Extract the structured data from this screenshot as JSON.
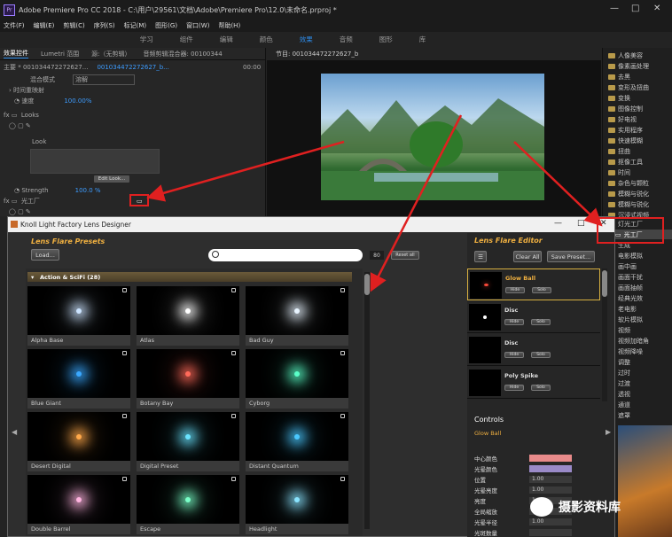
{
  "titlebar": {
    "title": "Adobe Premiere Pro CC 2018 - C:\\用户\\29561\\文档\\Adobe\\Premiere Pro\\12.0\\未命名.prproj *",
    "logo": "Pr"
  },
  "menu": [
    "文件(F)",
    "编辑(E)",
    "剪辑(C)",
    "序列(S)",
    "标记(M)",
    "图形(G)",
    "窗口(W)",
    "帮助(H)"
  ],
  "workspaces": {
    "items": [
      "学习",
      "组件",
      "编辑",
      "颜色",
      "效果",
      "音频",
      "图形",
      "库"
    ],
    "active": "效果"
  },
  "ec": {
    "tabs": [
      "效果控件",
      "Lumetri 范围",
      "源:（无剪辑）",
      "音频剪辑混合器: 00100344"
    ],
    "master": "主要 * 001034472272627...",
    "clip": "001034472272627_b...",
    "timecode": "00:00",
    "blend_label": "混合模式",
    "blend_value": "溶解",
    "time_remap": "时间重映射",
    "speed_label": "速度",
    "speed_value": "100.00%",
    "looks": "Looks",
    "look": "Look",
    "edit_look": "Edit Look...",
    "strength_label": "Strength",
    "strength_value": "100.0 %",
    "light_factory": "光工厂"
  },
  "program": {
    "title": "节目: 001034472272627_b"
  },
  "effects_panel": {
    "items": [
      "人像美容",
      "像素画处理",
      "去黑",
      "变形及扭曲",
      "变换",
      "图像控制",
      "好电视",
      "实用程序",
      "快速模糊",
      "扭曲",
      "抠像工具",
      "时间",
      "杂色与颗粒",
      "模糊与锐化",
      "模糊与锐化",
      "沉浸式视频",
      "灯光工厂",
      "光工厂",
      "生成",
      "电影模拟",
      "画中画",
      "画面干扰",
      "画面抽帧",
      "经典光效",
      "老电影",
      "软片模拟",
      "视频",
      "视频加暗角",
      "视频降噪",
      "调整",
      "过时",
      "过渡",
      "透视",
      "通道",
      "遮罩"
    ],
    "highlighted": "光工厂"
  },
  "knoll": {
    "title": "Knoll Light Factory Lens Designer",
    "presets_title": "Lens Flare Presets",
    "load_button": "Load...",
    "search_placeholder": "",
    "pct": "80",
    "reset_button": "Reset all",
    "category": "Action & SciFi (28)",
    "presets": [
      {
        "name": "Alpha Base",
        "color": "#cce4ff"
      },
      {
        "name": "Atlas",
        "color": "#ffffff"
      },
      {
        "name": "Bad Guy",
        "color": "#e8f4ff"
      },
      {
        "name": "Blue Giant",
        "color": "#3aa8ff"
      },
      {
        "name": "Botany Bay",
        "color": "#ff6a5a"
      },
      {
        "name": "Cyborg",
        "color": "#5affc8"
      },
      {
        "name": "Desert Digital",
        "color": "#ffa84a"
      },
      {
        "name": "Digital Preset",
        "color": "#6ae4ff"
      },
      {
        "name": "Distant Quantum",
        "color": "#4ac8ff"
      },
      {
        "name": "Double Barrel",
        "color": "#ffb4e0"
      },
      {
        "name": "Escape",
        "color": "#7affc8"
      },
      {
        "name": "Headlight",
        "color": "#8ae4ff"
      }
    ],
    "editor_title": "Lens Flare Editor",
    "clear_button": "Clear All",
    "save_button": "Save Preset...",
    "elements": [
      {
        "name": "Glow Ball",
        "btn1": "Hide",
        "btn2": "Solo",
        "selected": true
      },
      {
        "name": "Disc",
        "btn1": "Hide",
        "btn2": "Solo",
        "selected": false
      },
      {
        "name": "Disc",
        "btn1": "Hide",
        "btn2": "Solo",
        "selected": false
      },
      {
        "name": "Poly Spike",
        "btn1": "Hide",
        "btn2": "Solo",
        "selected": false
      }
    ],
    "controls_title": "Controls",
    "controls_sub": "Glow Ball",
    "controls": [
      {
        "label": "中心颜色",
        "value": "",
        "swatch": "#e88a8a"
      },
      {
        "label": "光晕颜色",
        "value": "",
        "swatch": "#9a8ac8"
      },
      {
        "label": "位置",
        "value": "1.00"
      },
      {
        "label": "光晕亮度",
        "value": "1.00"
      },
      {
        "label": "亮度",
        "value": "1.00"
      },
      {
        "label": "全局缩放",
        "value": "1.00"
      },
      {
        "label": "光晕半径",
        "value": "1.00"
      },
      {
        "label": "光斑数量",
        "value": ""
      }
    ]
  },
  "watermark": {
    "text": "摄影资料库"
  },
  "colors": {
    "accent": "#2d8ceb",
    "annotation": "#e02020",
    "preset_title": "#f0b040"
  }
}
